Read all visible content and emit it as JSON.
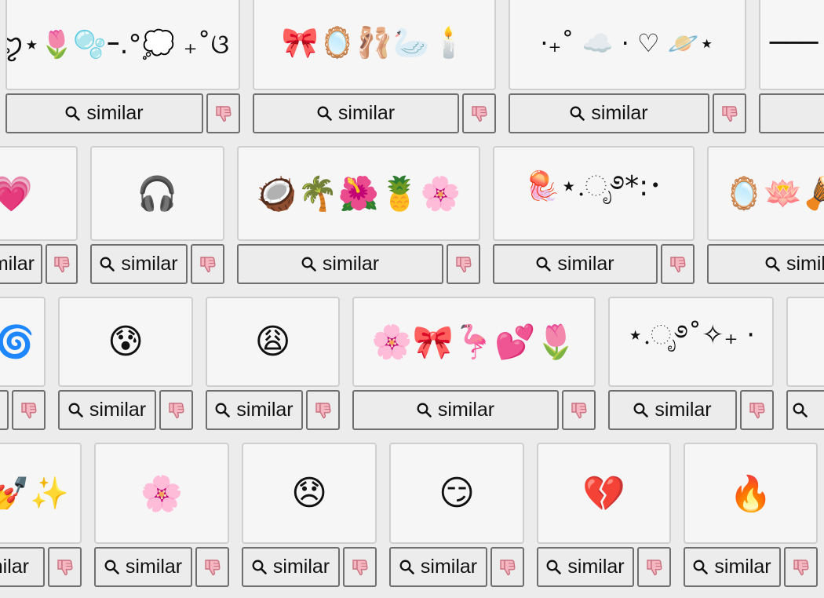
{
  "similar_label": "similar",
  "icons": {
    "search": "magnifier-icon",
    "dislike": "thumbs-down-icon"
  },
  "colors": {
    "background": "#ececec",
    "card_bg": "#f6f6f6",
    "card_border": "#cfcfcf",
    "button_border": "#6f6f6f",
    "thumb_fill": "#f4b6c0"
  },
  "rows": [
    {
      "items": [
        {
          "content": "ꨄ⋆🌷🫧ｰ.°💭 ₊˚ଓ"
        },
        {
          "content": "🎀🪞🩰🦢🕯️"
        },
        {
          "content": "·₊˚ ☁️ · ♡ 🪐⋆"
        },
        {
          "content": "───"
        }
      ]
    },
    {
      "items": [
        {
          "content": "💗"
        },
        {
          "content": "🎧"
        },
        {
          "content": "🥥🌴🌺🍍🌸"
        },
        {
          "content": "🪼⋆.ೃ࿔*:･"
        },
        {
          "content": "🪞🪷🪘"
        }
      ]
    },
    {
      "items": [
        {
          "content": "🌀"
        },
        {
          "content": "😰"
        },
        {
          "content": "😩"
        },
        {
          "content": "🌸🎀🦩💕🌷"
        },
        {
          "content": "⋆.ೃ࿔˚✧₊ ·"
        },
        {
          "content": ""
        }
      ]
    },
    {
      "items": [
        {
          "content": "💅✨"
        },
        {
          "content": "🌸"
        },
        {
          "content": "😞"
        },
        {
          "content": "😏"
        },
        {
          "content": "💔"
        },
        {
          "content": "🔥"
        }
      ]
    }
  ]
}
